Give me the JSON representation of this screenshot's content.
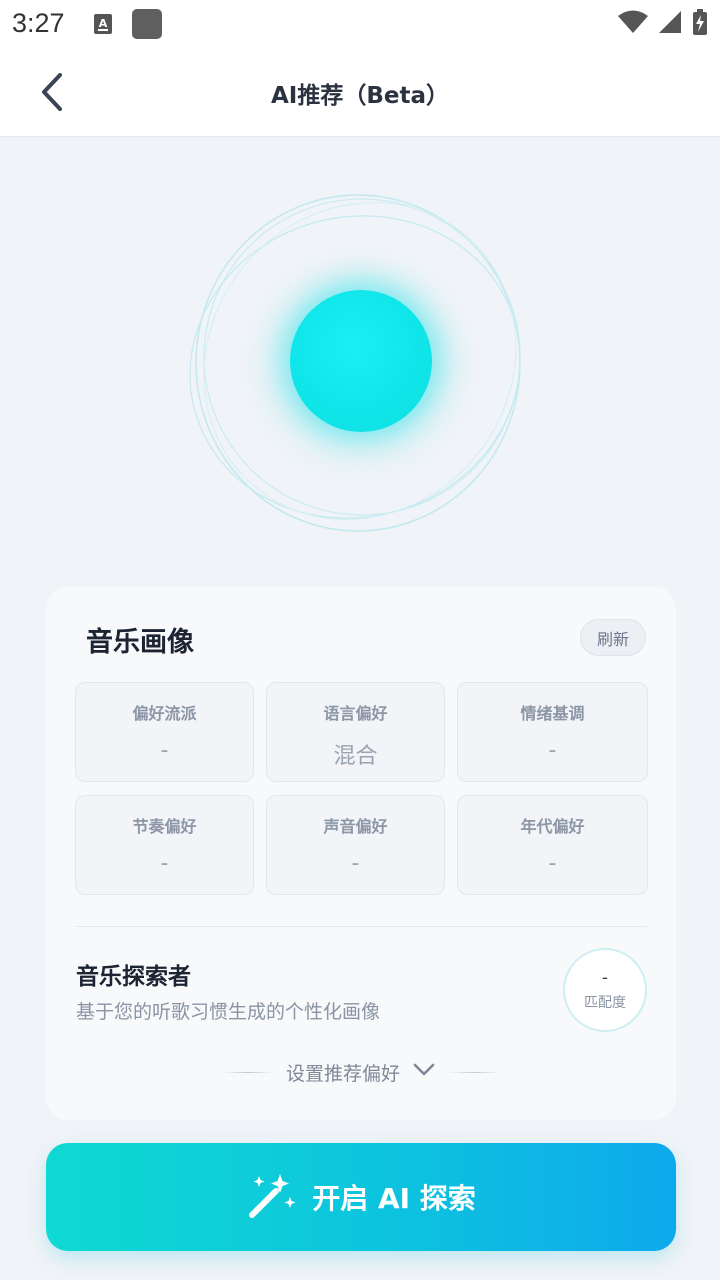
{
  "status_bar": {
    "time": "3:27"
  },
  "header": {
    "title": "AI推荐（Beta）"
  },
  "profile": {
    "title": "音乐画像",
    "refresh_label": "刷新",
    "preferences": [
      {
        "label": "偏好流派",
        "value": "-"
      },
      {
        "label": "语言偏好",
        "value": "混合"
      },
      {
        "label": "情绪基调",
        "value": "-"
      },
      {
        "label": "节奏偏好",
        "value": "-"
      },
      {
        "label": "声音偏好",
        "value": "-"
      },
      {
        "label": "年代偏好",
        "value": "-"
      }
    ],
    "persona": {
      "title": "音乐探索者",
      "description": "基于您的听歌习惯生成的个性化画像"
    },
    "match": {
      "value": "-",
      "label": "匹配度"
    },
    "settings_label": "设置推荐偏好"
  },
  "start_button": {
    "label": "开启 AI 探索",
    "icon": "magic-wand-icon"
  },
  "colors": {
    "accent_start": "#0fd9d2",
    "accent_end": "#0ea9ec",
    "orb": "#10e6ea"
  }
}
